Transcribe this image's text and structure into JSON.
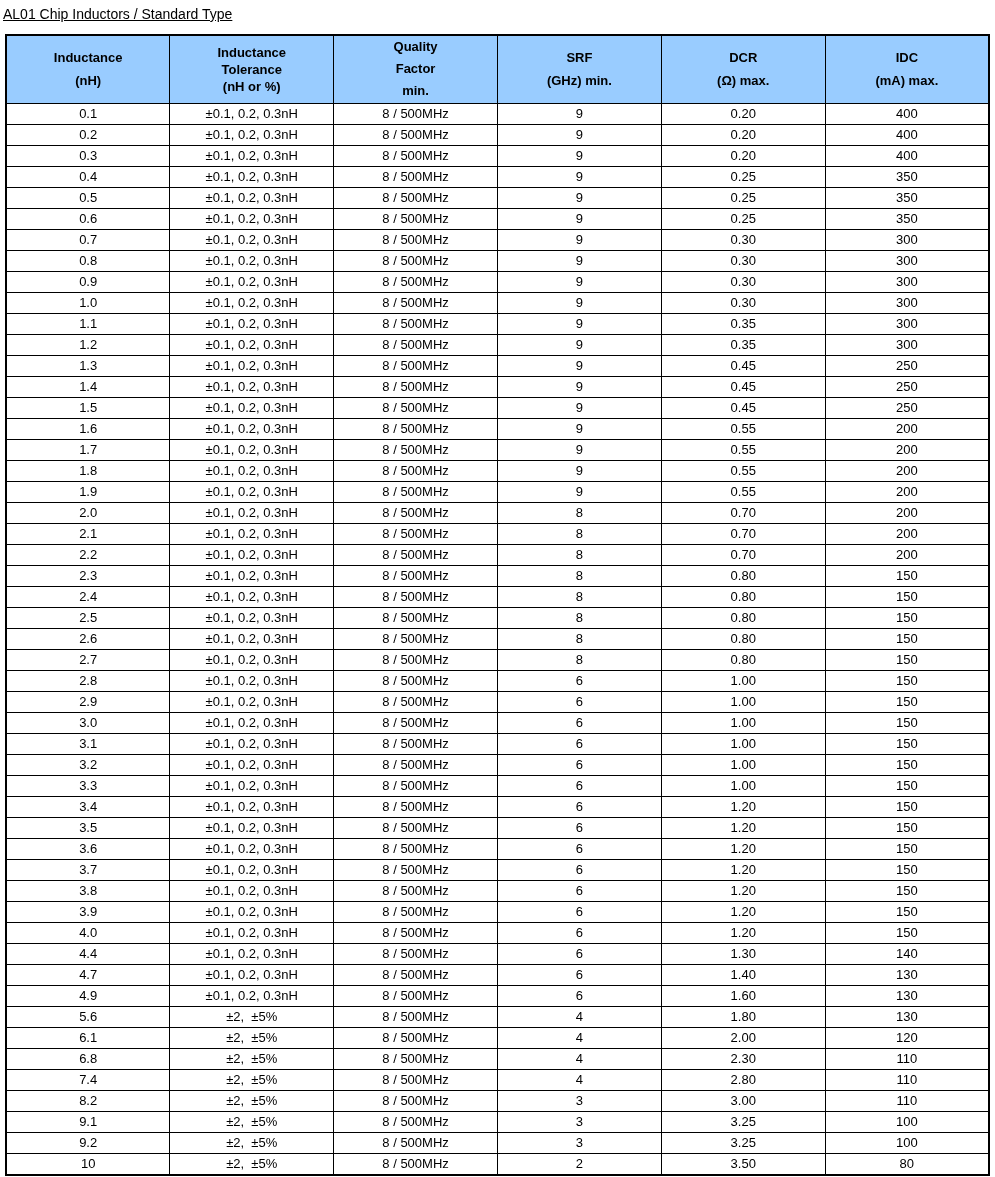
{
  "title": "AL01 Chip Inductors / Standard Type",
  "table": {
    "columns": [
      "Inductance\n(nH)",
      "Inductance\nTolerance\n(nH or %)",
      "Quality\nFactor\nmin.",
      "SRF\n(GHz) min.",
      "DCR\n(Ω) max.",
      "IDC\n(mA) max."
    ],
    "rows": [
      [
        "0.1",
        "±0.1, 0.2, 0.3nH",
        "8 / 500MHz",
        "9",
        "0.20",
        "400"
      ],
      [
        "0.2",
        "±0.1, 0.2, 0.3nH",
        "8 / 500MHz",
        "9",
        "0.20",
        "400"
      ],
      [
        "0.3",
        "±0.1, 0.2, 0.3nH",
        "8 / 500MHz",
        "9",
        "0.20",
        "400"
      ],
      [
        "0.4",
        "±0.1, 0.2, 0.3nH",
        "8 / 500MHz",
        "9",
        "0.25",
        "350"
      ],
      [
        "0.5",
        "±0.1, 0.2, 0.3nH",
        "8 / 500MHz",
        "9",
        "0.25",
        "350"
      ],
      [
        "0.6",
        "±0.1, 0.2, 0.3nH",
        "8 / 500MHz",
        "9",
        "0.25",
        "350"
      ],
      [
        "0.7",
        "±0.1, 0.2, 0.3nH",
        "8 / 500MHz",
        "9",
        "0.30",
        "300"
      ],
      [
        "0.8",
        "±0.1, 0.2, 0.3nH",
        "8 / 500MHz",
        "9",
        "0.30",
        "300"
      ],
      [
        "0.9",
        "±0.1, 0.2, 0.3nH",
        "8 / 500MHz",
        "9",
        "0.30",
        "300"
      ],
      [
        "1.0",
        "±0.1, 0.2, 0.3nH",
        "8 / 500MHz",
        "9",
        "0.30",
        "300"
      ],
      [
        "1.1",
        "±0.1, 0.2, 0.3nH",
        "8 / 500MHz",
        "9",
        "0.35",
        "300"
      ],
      [
        "1.2",
        "±0.1, 0.2, 0.3nH",
        "8 / 500MHz",
        "9",
        "0.35",
        "300"
      ],
      [
        "1.3",
        "±0.1, 0.2, 0.3nH",
        "8 / 500MHz",
        "9",
        "0.45",
        "250"
      ],
      [
        "1.4",
        "±0.1, 0.2, 0.3nH",
        "8 / 500MHz",
        "9",
        "0.45",
        "250"
      ],
      [
        "1.5",
        "±0.1, 0.2, 0.3nH",
        "8 / 500MHz",
        "9",
        "0.45",
        "250"
      ],
      [
        "1.6",
        "±0.1, 0.2, 0.3nH",
        "8 / 500MHz",
        "9",
        "0.55",
        "200"
      ],
      [
        "1.7",
        "±0.1, 0.2, 0.3nH",
        "8 / 500MHz",
        "9",
        "0.55",
        "200"
      ],
      [
        "1.8",
        "±0.1, 0.2, 0.3nH",
        "8 / 500MHz",
        "9",
        "0.55",
        "200"
      ],
      [
        "1.9",
        "±0.1, 0.2, 0.3nH",
        "8 / 500MHz",
        "9",
        "0.55",
        "200"
      ],
      [
        "2.0",
        "±0.1, 0.2, 0.3nH",
        "8 / 500MHz",
        "8",
        "0.70",
        "200"
      ],
      [
        "2.1",
        "±0.1, 0.2, 0.3nH",
        "8 / 500MHz",
        "8",
        "0.70",
        "200"
      ],
      [
        "2.2",
        "±0.1, 0.2, 0.3nH",
        "8 / 500MHz",
        "8",
        "0.70",
        "200"
      ],
      [
        "2.3",
        "±0.1, 0.2, 0.3nH",
        "8 / 500MHz",
        "8",
        "0.80",
        "150"
      ],
      [
        "2.4",
        "±0.1, 0.2, 0.3nH",
        "8 / 500MHz",
        "8",
        "0.80",
        "150"
      ],
      [
        "2.5",
        "±0.1, 0.2, 0.3nH",
        "8 / 500MHz",
        "8",
        "0.80",
        "150"
      ],
      [
        "2.6",
        "±0.1, 0.2, 0.3nH",
        "8 / 500MHz",
        "8",
        "0.80",
        "150"
      ],
      [
        "2.7",
        "±0.1, 0.2, 0.3nH",
        "8 / 500MHz",
        "8",
        "0.80",
        "150"
      ],
      [
        "2.8",
        "±0.1, 0.2, 0.3nH",
        "8 / 500MHz",
        "6",
        "1.00",
        "150"
      ],
      [
        "2.9",
        "±0.1, 0.2, 0.3nH",
        "8 / 500MHz",
        "6",
        "1.00",
        "150"
      ],
      [
        "3.0",
        "±0.1, 0.2, 0.3nH",
        "8 / 500MHz",
        "6",
        "1.00",
        "150"
      ],
      [
        "3.1",
        "±0.1, 0.2, 0.3nH",
        "8 / 500MHz",
        "6",
        "1.00",
        "150"
      ],
      [
        "3.2",
        "±0.1, 0.2, 0.3nH",
        "8 / 500MHz",
        "6",
        "1.00",
        "150"
      ],
      [
        "3.3",
        "±0.1, 0.2, 0.3nH",
        "8 / 500MHz",
        "6",
        "1.00",
        "150"
      ],
      [
        "3.4",
        "±0.1, 0.2, 0.3nH",
        "8 / 500MHz",
        "6",
        "1.20",
        "150"
      ],
      [
        "3.5",
        "±0.1, 0.2, 0.3nH",
        "8 / 500MHz",
        "6",
        "1.20",
        "150"
      ],
      [
        "3.6",
        "±0.1, 0.2, 0.3nH",
        "8 / 500MHz",
        "6",
        "1.20",
        "150"
      ],
      [
        "3.7",
        "±0.1, 0.2, 0.3nH",
        "8 / 500MHz",
        "6",
        "1.20",
        "150"
      ],
      [
        "3.8",
        "±0.1, 0.2, 0.3nH",
        "8 / 500MHz",
        "6",
        "1.20",
        "150"
      ],
      [
        "3.9",
        "±0.1, 0.2, 0.3nH",
        "8 / 500MHz",
        "6",
        "1.20",
        "150"
      ],
      [
        "4.0",
        "±0.1, 0.2, 0.3nH",
        "8 / 500MHz",
        "6",
        "1.20",
        "150"
      ],
      [
        "4.4",
        "±0.1, 0.2, 0.3nH",
        "8 / 500MHz",
        "6",
        "1.30",
        "140"
      ],
      [
        "4.7",
        "±0.1, 0.2, 0.3nH",
        "8 / 500MHz",
        "6",
        "1.40",
        "130"
      ],
      [
        "4.9",
        "±0.1, 0.2, 0.3nH",
        "8 / 500MHz",
        "6",
        "1.60",
        "130"
      ],
      [
        "5.6",
        "±2,  ±5%",
        "8 / 500MHz",
        "4",
        "1.80",
        "130"
      ],
      [
        "6.1",
        "±2,  ±5%",
        "8 / 500MHz",
        "4",
        "2.00",
        "120"
      ],
      [
        "6.8",
        "±2,  ±5%",
        "8 / 500MHz",
        "4",
        "2.30",
        "110"
      ],
      [
        "7.4",
        "±2,  ±5%",
        "8 / 500MHz",
        "4",
        "2.80",
        "110"
      ],
      [
        "8.2",
        "±2,  ±5%",
        "8 / 500MHz",
        "3",
        "3.00",
        "110"
      ],
      [
        "9.1",
        "±2,  ±5%",
        "8 / 500MHz",
        "3",
        "3.25",
        "100"
      ],
      [
        "9.2",
        "±2,  ±5%",
        "8 / 500MHz",
        "3",
        "3.25",
        "100"
      ],
      [
        "10",
        "±2,  ±5%",
        "8 / 500MHz",
        "2",
        "3.50",
        "80"
      ]
    ]
  }
}
